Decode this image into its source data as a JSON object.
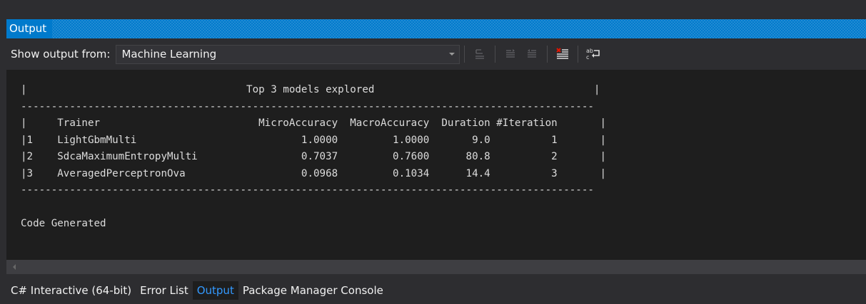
{
  "window": {
    "title": "Output"
  },
  "toolbar": {
    "show_output_label": "Show output from:",
    "source_selected": "Machine Learning",
    "icons": [
      "go-to-previous-message-icon",
      "align-left-icon",
      "align-right-icon",
      "clear-all-icon",
      "word-wrap-icon"
    ]
  },
  "console": {
    "lines": [
      "|                                    Top 3 models explored                                    |",
      "----------------------------------------------------------------------------------------------",
      "|     Trainer                          MicroAccuracy  MacroAccuracy  Duration #Iteration       |",
      "|1    LightGbmMulti                           1.0000         1.0000       9.0          1       |",
      "|2    SdcaMaximumEntropyMulti                 0.7037         0.7600      80.8          2       |",
      "|3    AveragedPerceptronOva                   0.0968         0.1034      14.4          3       |",
      "----------------------------------------------------------------------------------------------",
      "",
      "Code Generated"
    ]
  },
  "tabs": [
    {
      "label": "C# Interactive (64-bit)",
      "active": false
    },
    {
      "label": "Error List",
      "active": false
    },
    {
      "label": "Output",
      "active": true
    },
    {
      "label": "Package Manager Console",
      "active": false
    }
  ],
  "colors": {
    "accent": "#007acc",
    "active_tab_text": "#3399ff",
    "console_bg": "#1e1e1e",
    "chrome_bg": "#2d2d30"
  }
}
